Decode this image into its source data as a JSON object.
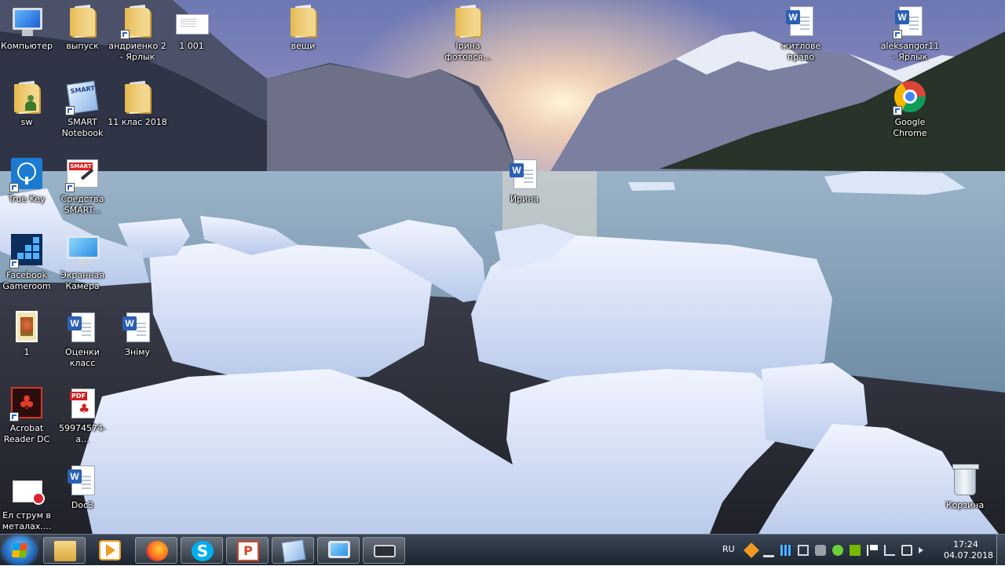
{
  "desktop": {
    "icons": [
      {
        "label": "Компьютер"
      },
      {
        "label": "выпуск"
      },
      {
        "label": "андриенко 2 - Ярлык"
      },
      {
        "label": "1 001"
      },
      {
        "label": "вещи"
      },
      {
        "label": "Ірина фотовся..."
      },
      {
        "label": "житлове право"
      },
      {
        "label": "aleksangor11 - Ярлык"
      },
      {
        "label": "sw"
      },
      {
        "label": "SMART Notebook"
      },
      {
        "label": "11 клас 2018"
      },
      {
        "label": "Google Chrome"
      },
      {
        "label": "True Key"
      },
      {
        "label": "Средства SMART..."
      },
      {
        "label": "Ирина"
      },
      {
        "label": "Facebook Gameroom"
      },
      {
        "label": "Экранная Камера"
      },
      {
        "label": "1"
      },
      {
        "label": "Оценки класс"
      },
      {
        "label": "Зніму"
      },
      {
        "label": "Acrobat Reader DC"
      },
      {
        "label": "59974574-a..."
      },
      {
        "label": "Ел струм в металах...."
      },
      {
        "label": "Doc3"
      },
      {
        "label": "Корзина"
      }
    ],
    "badges": {
      "word": "W",
      "pdf": "PDF",
      "smart": "SMART"
    }
  },
  "taskbar": {
    "pinned": [
      {
        "name": "Windows Explorer",
        "icon": "folder-icon"
      },
      {
        "name": "Media Player",
        "icon": "media-player-icon"
      },
      {
        "name": "Firefox",
        "icon": "firefox-icon"
      },
      {
        "name": "Skype",
        "icon": "skype-icon",
        "glyph": "S"
      },
      {
        "name": "PowerPoint",
        "icon": "powerpoint-icon",
        "glyph": "P"
      },
      {
        "name": "SMART Notebook",
        "icon": "smart-icon"
      },
      {
        "name": "Экранная Камера",
        "icon": "monitor-icon"
      },
      {
        "name": "Screen recorder",
        "icon": "camera-icon"
      }
    ],
    "tray": {
      "language": "RU",
      "time": "17:24",
      "date": "04.07.2018"
    }
  }
}
